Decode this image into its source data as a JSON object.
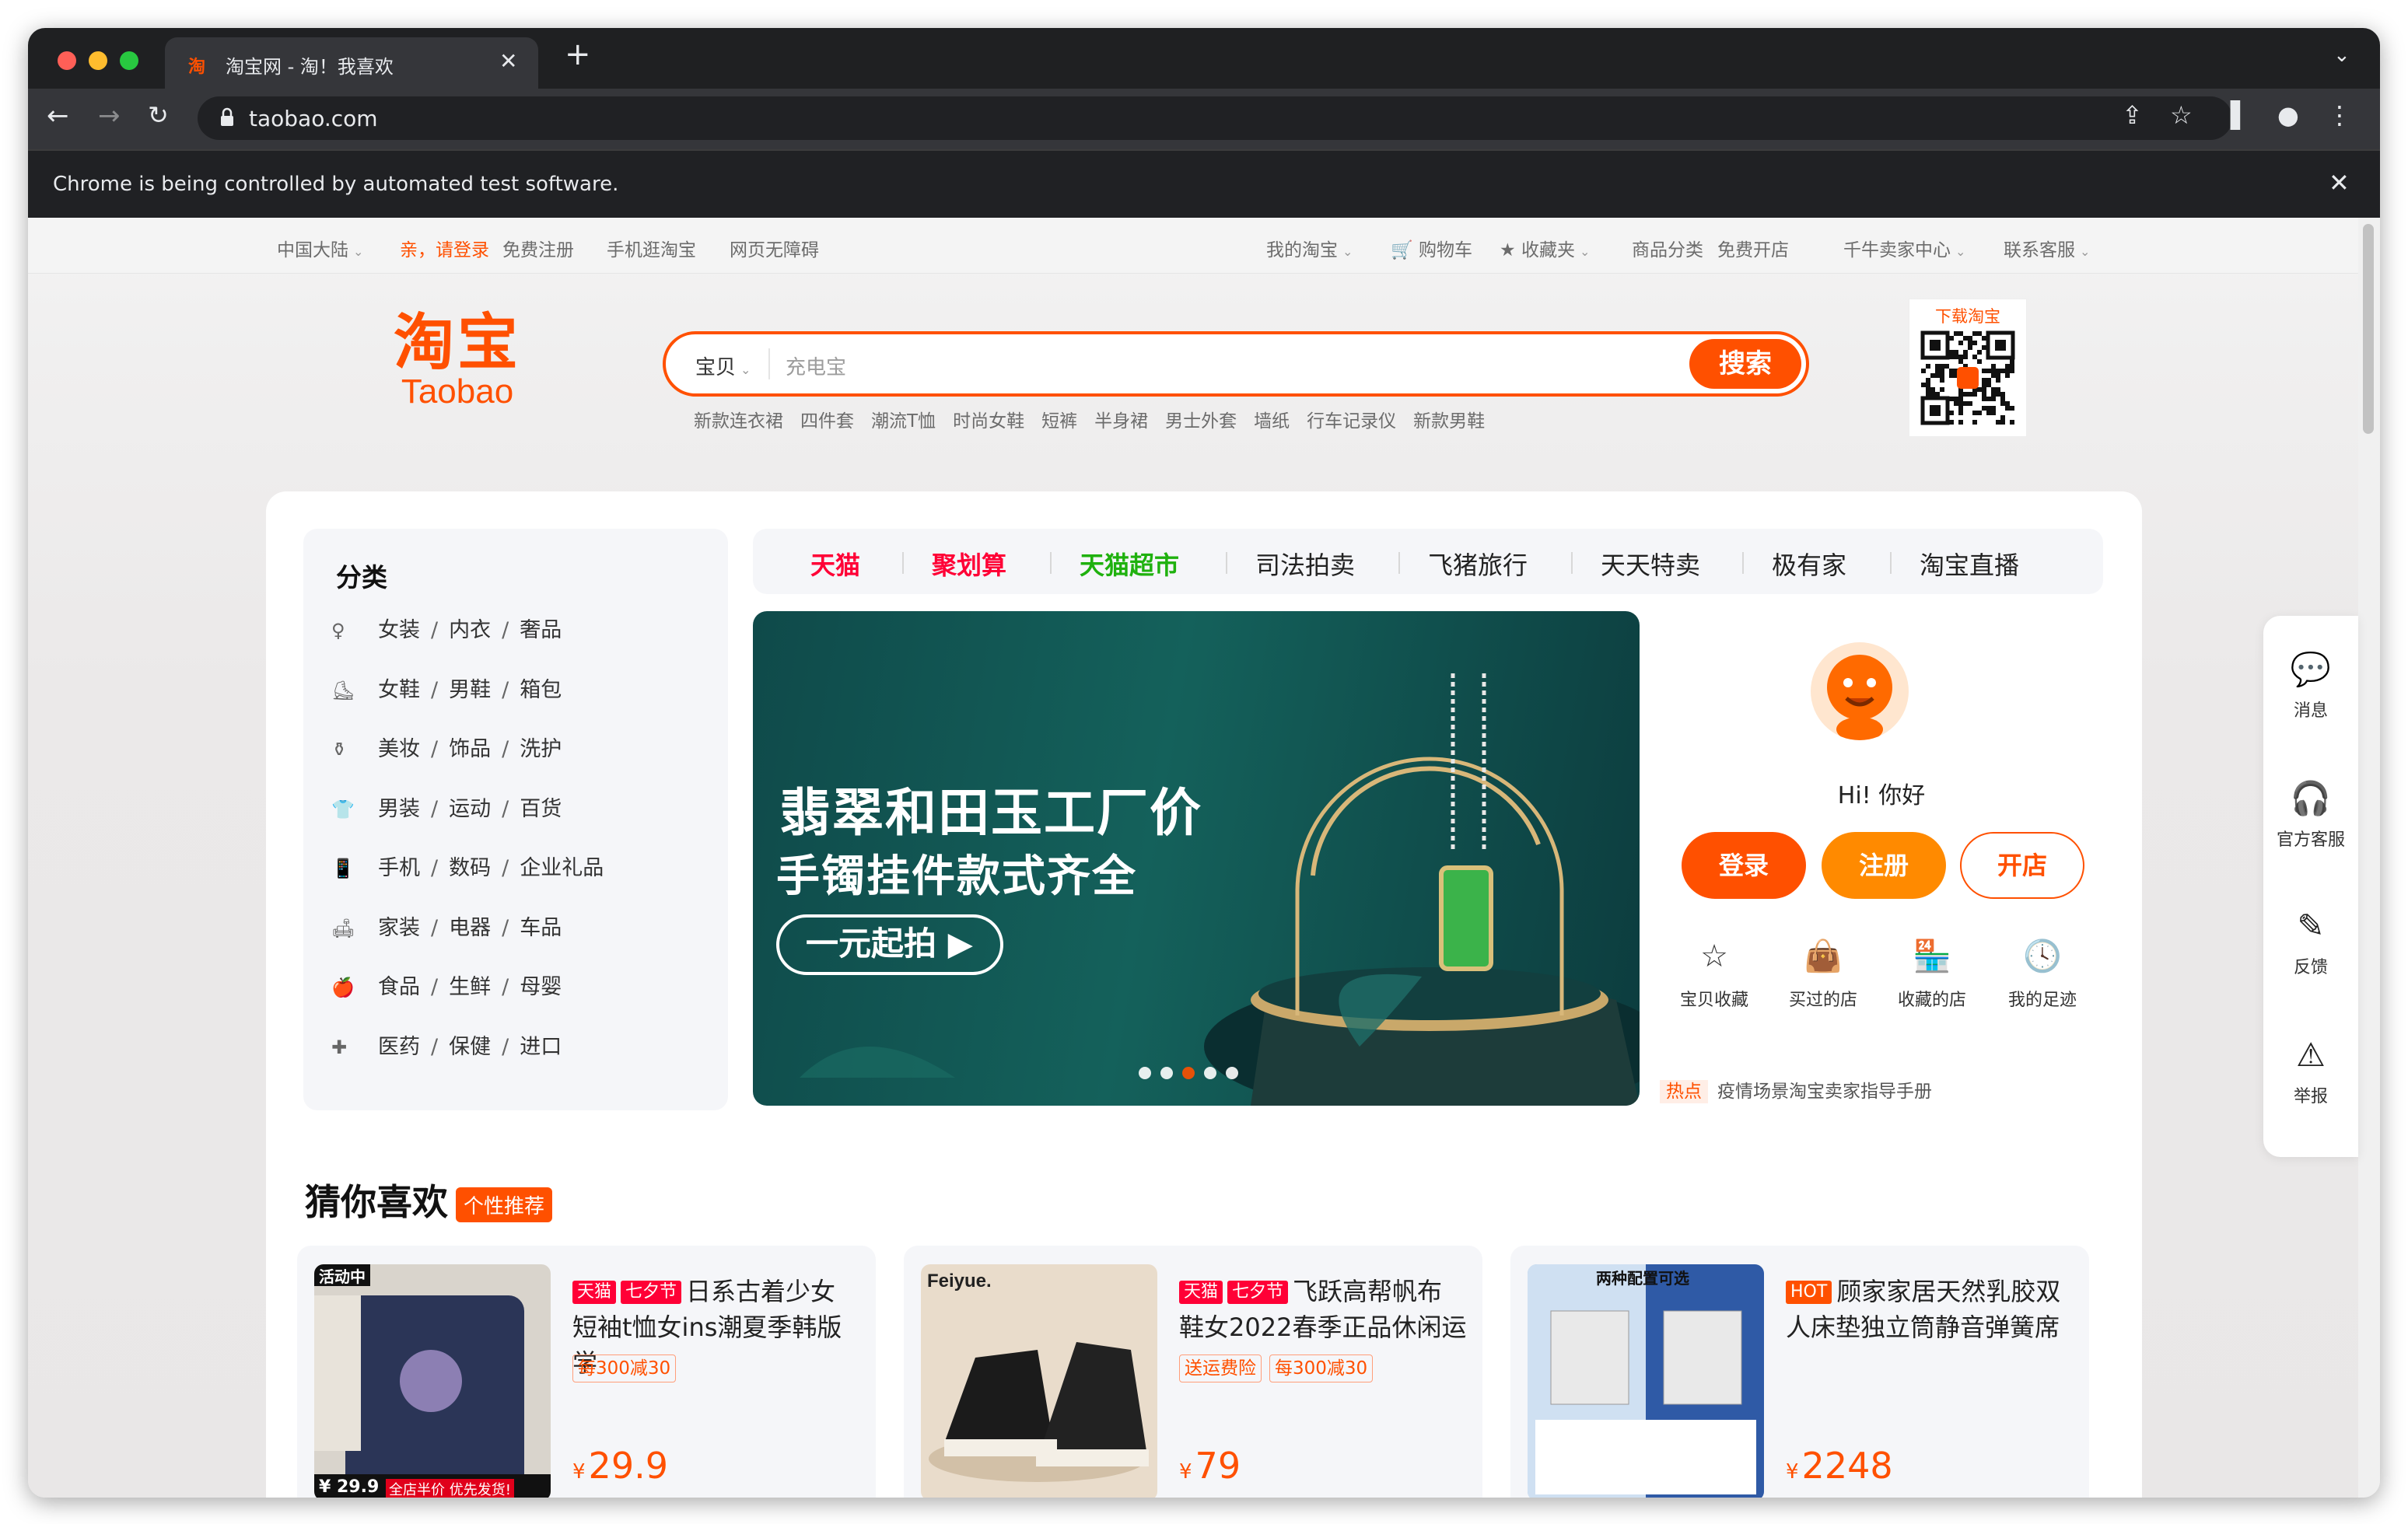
{
  "browser": {
    "tab_title": "淘宝网 - 淘！我喜欢",
    "tab_icon": "淘",
    "url": "taobao.com",
    "infobar": "Chrome is being controlled by automated test software."
  },
  "sitenav": {
    "region": "中国大陆",
    "login": "亲，请登录",
    "register": "免费注册",
    "mobile": "手机逛淘宝",
    "accessible": "网页无障碍",
    "my_taobao": "我的淘宝",
    "cart": "购物车",
    "favorites": "收藏夹",
    "categories": "商品分类",
    "open_shop": "免费开店",
    "seller_center": "千牛卖家中心",
    "service": "联系客服"
  },
  "logo": {
    "cn": "淘宝",
    "en": "Taobao"
  },
  "search": {
    "category": "宝贝",
    "placeholder": "充电宝",
    "button": "搜索",
    "hot": [
      "新款连衣裙",
      "四件套",
      "潮流T恤",
      "时尚女鞋",
      "短裤",
      "半身裙",
      "男士外套",
      "墙纸",
      "行车记录仪",
      "新款男鞋"
    ]
  },
  "qr": {
    "title": "下载淘宝"
  },
  "categories": {
    "title": "分类",
    "rows": [
      [
        "女装",
        "内衣",
        "奢品"
      ],
      [
        "女鞋",
        "男鞋",
        "箱包"
      ],
      [
        "美妆",
        "饰品",
        "洗护"
      ],
      [
        "男装",
        "运动",
        "百货"
      ],
      [
        "手机",
        "数码",
        "企业礼品"
      ],
      [
        "家装",
        "电器",
        "车品"
      ],
      [
        "食品",
        "生鲜",
        "母婴"
      ],
      [
        "医药",
        "保健",
        "进口"
      ]
    ]
  },
  "channels": [
    {
      "label": "天猫",
      "color": "#ff0036"
    },
    {
      "label": "聚划算",
      "color": "#ff0036"
    },
    {
      "label": "天猫超市",
      "color": "#1fb10e"
    },
    {
      "label": "司法拍卖",
      "color": "#222222"
    },
    {
      "label": "飞猪旅行",
      "color": "#222222"
    },
    {
      "label": "天天特卖",
      "color": "#222222"
    },
    {
      "label": "极有家",
      "color": "#222222"
    },
    {
      "label": "淘宝直播",
      "color": "#222222"
    }
  ],
  "banner": {
    "line1": "翡翠和田玉工厂价",
    "line2": "手镯挂件款式齐全",
    "button": "一元起拍"
  },
  "user": {
    "greeting": "Hi! 你好",
    "login": "登录",
    "register": "注册",
    "open_shop": "开店",
    "quick": [
      "宝贝收藏",
      "买过的店",
      "收藏的店",
      "我的足迹"
    ],
    "news_tag": "热点",
    "news": "疫情场景淘宝卖家指导手册"
  },
  "guess": {
    "title": "猜你喜欢",
    "tag": "个性推荐"
  },
  "products": [
    {
      "badges": [
        "天猫",
        "七夕节"
      ],
      "title": "日系古着少女短袖t恤女ins潮夏季韩版学",
      "coupons": [
        "每300减30"
      ],
      "currency": "¥",
      "price": "29.9",
      "img_tag": "活动中",
      "img_footer": "全店半价 优先发货!",
      "img_price": "¥ 29.9"
    },
    {
      "badges": [
        "天猫",
        "七夕节"
      ],
      "title": "飞跃高帮帆布鞋女2022春季正品休闲运",
      "coupons": [
        "送运费险",
        "每300减30"
      ],
      "currency": "¥",
      "price": "79",
      "img_brand": "Feiyue."
    },
    {
      "badges": [
        "HOT"
      ],
      "title": "顾家家居天然乳胶双人床垫独立筒静音弹簧席",
      "coupons": [],
      "currency": "¥",
      "price": "2248",
      "img_tag": "两种配置可选"
    }
  ],
  "side": [
    "消息",
    "官方客服",
    "反馈",
    "举报"
  ],
  "colors": {
    "accent": "#ff5000",
    "tmall": "#ff0036",
    "chaoshi": "#1fb10e"
  }
}
